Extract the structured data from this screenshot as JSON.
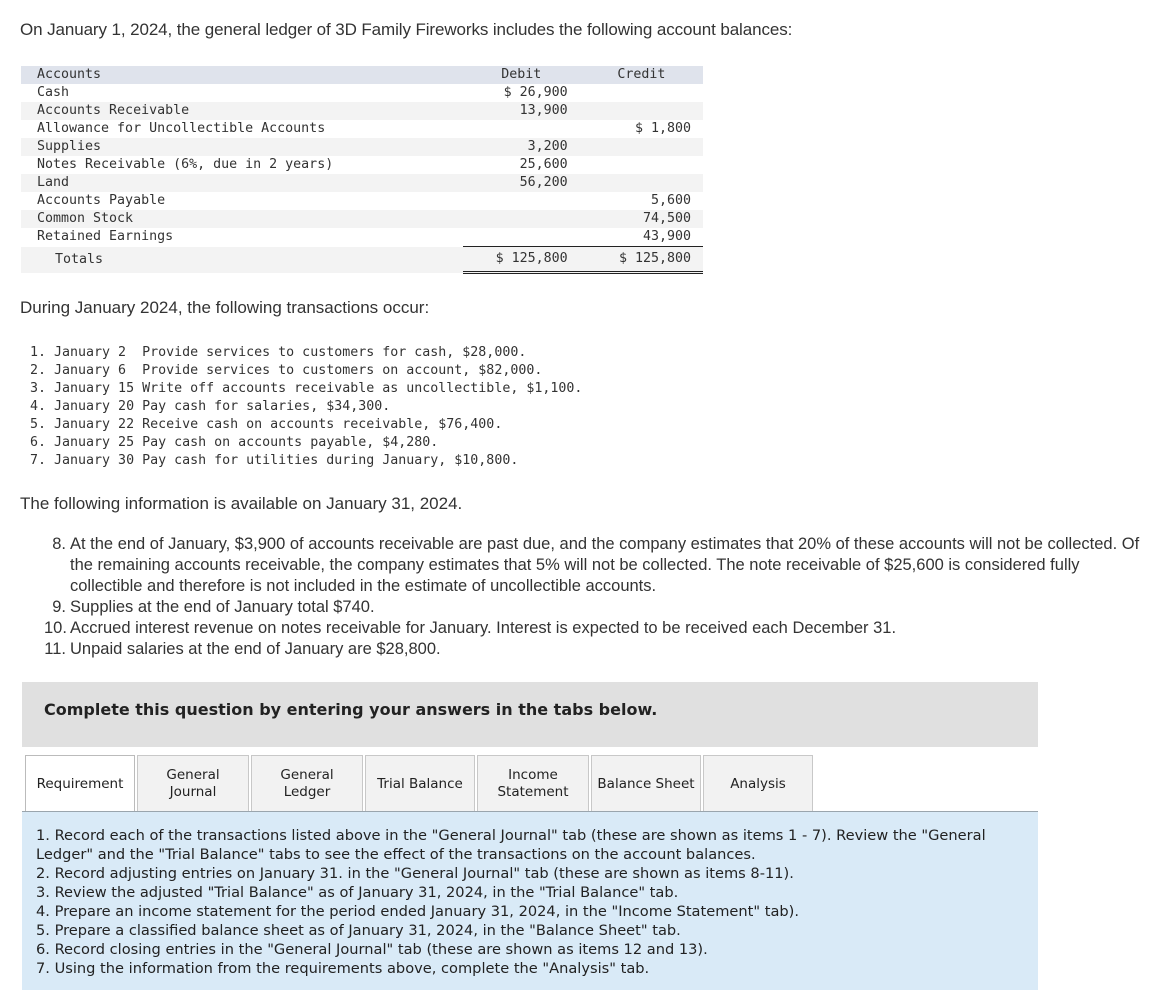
{
  "intro": "On January 1, 2024, the general ledger of 3D Family Fireworks includes the following account balances:",
  "ledger": {
    "headers": {
      "account": "Accounts",
      "debit": "Debit",
      "credit": "Credit"
    },
    "rows": [
      {
        "account": "Cash",
        "debit": "$ 26,900",
        "credit": ""
      },
      {
        "account": "Accounts Receivable",
        "debit": "13,900",
        "credit": ""
      },
      {
        "account": "Allowance for Uncollectible Accounts",
        "debit": "",
        "credit": "$ 1,800"
      },
      {
        "account": "Supplies",
        "debit": "3,200",
        "credit": ""
      },
      {
        "account": "Notes Receivable (6%, due in 2 years)",
        "debit": "25,600",
        "credit": ""
      },
      {
        "account": "Land",
        "debit": "56,200",
        "credit": ""
      },
      {
        "account": "Accounts Payable",
        "debit": "",
        "credit": "5,600"
      },
      {
        "account": "Common Stock",
        "debit": "",
        "credit": "74,500"
      },
      {
        "account": "Retained Earnings",
        "debit": "",
        "credit": "43,900"
      }
    ],
    "totals": {
      "label": "Totals",
      "debit": "$ 125,800",
      "credit": "$ 125,800"
    }
  },
  "transactions_intro": "During January 2024, the following transactions occur:",
  "transactions": [
    {
      "num": "1.",
      "date": "January 2 ",
      "text": "Provide services to customers for cash, $28,000."
    },
    {
      "num": "2.",
      "date": "January 6 ",
      "text": "Provide services to customers on account, $82,000."
    },
    {
      "num": "3.",
      "date": "January 15",
      "text": "Write off accounts receivable as uncollectible, $1,100."
    },
    {
      "num": "4.",
      "date": "January 20",
      "text": "Pay cash for salaries, $34,300."
    },
    {
      "num": "5.",
      "date": "January 22",
      "text": "Receive cash on accounts receivable, $76,400."
    },
    {
      "num": "6.",
      "date": "January 25",
      "text": "Pay cash on accounts payable, $4,280."
    },
    {
      "num": "7.",
      "date": "January 30",
      "text": "Pay cash for utilities during January, $10,800."
    }
  ],
  "info_intro": "The following information is available on January 31, 2024.",
  "info_items": [
    {
      "num": "8.",
      "text": "At the end of January, $3,900 of accounts receivable are past due, and the company estimates that 20% of these accounts will not be collected. Of the remaining accounts receivable, the company estimates that 5% will not be collected. The note receivable of $25,600 is considered fully collectible and therefore is not included in the estimate of uncollectible accounts."
    },
    {
      "num": "9.",
      "text": "Supplies at the end of January total $740."
    },
    {
      "num": "10.",
      "text": "Accrued interest revenue on notes receivable for January. Interest is expected to be received each December 31."
    },
    {
      "num": "11.",
      "text": "Unpaid salaries at the end of January are $28,800."
    }
  ],
  "banner": "Complete this question by entering your answers in the tabs below.",
  "tabs": [
    {
      "line1": "Requirement",
      "line2": "",
      "active": true
    },
    {
      "line1": "General",
      "line2": "Journal",
      "active": false
    },
    {
      "line1": "General",
      "line2": "Ledger",
      "active": false
    },
    {
      "line1": "Trial Balance",
      "line2": "",
      "active": false
    },
    {
      "line1": "Income",
      "line2": "Statement",
      "active": false
    },
    {
      "line1": "Balance Sheet",
      "line2": "",
      "active": false
    },
    {
      "line1": "Analysis",
      "line2": "",
      "active": false
    }
  ],
  "requirements": [
    "1. Record each of the transactions listed above in the \"General Journal\" tab (these are shown as items 1 - 7). Review the \"General Ledger\" and the \"Trial Balance\" tabs to see the effect of the transactions on the account balances.",
    "2. Record adjusting entries on January 31. in the \"General Journal\" tab (these are shown as items 8-11).",
    "3. Review the adjusted \"Trial Balance\" as of January 31, 2024, in the \"Trial Balance\" tab.",
    "4. Prepare an income statement for the period ended January 31, 2024, in the \"Income Statement\" tab).",
    "5. Prepare a classified balance sheet as of January 31, 2024, in the \"Balance Sheet\" tab.",
    "6. Record closing entries in the \"General Journal\" tab (these are shown as items 12 and 13).",
    "7. Using the information from the requirements above, complete the \"Analysis\" tab."
  ]
}
